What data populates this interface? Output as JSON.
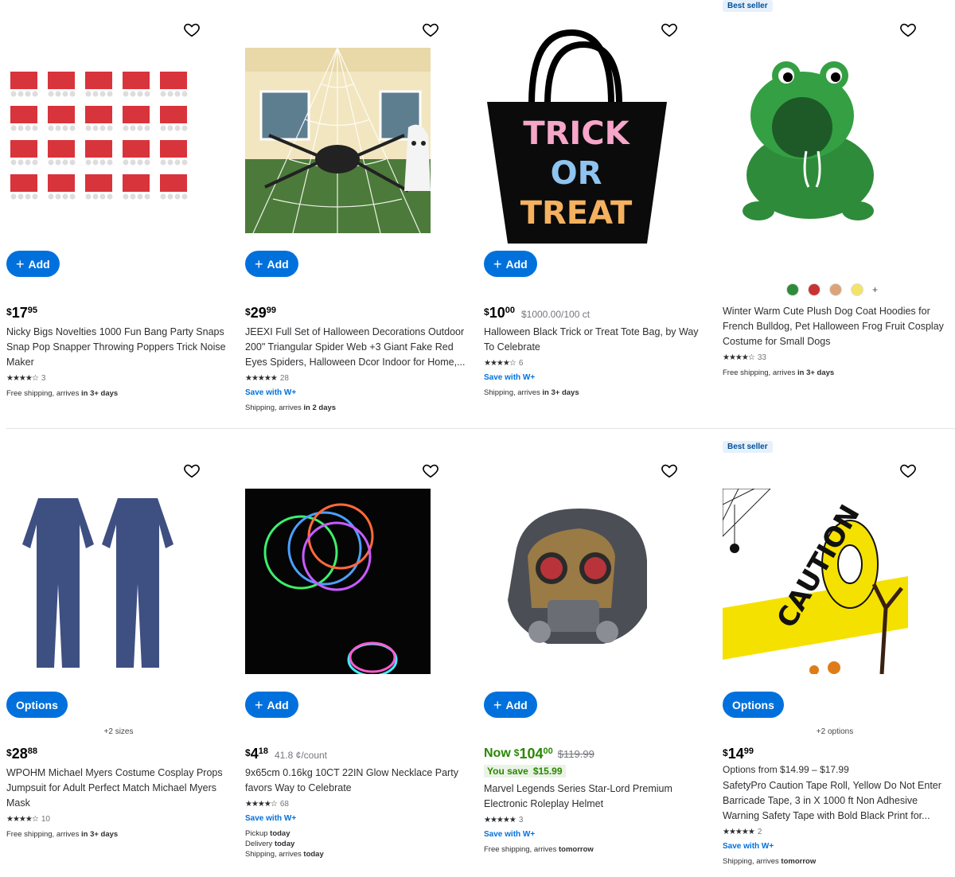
{
  "products": [
    {
      "badge": "",
      "button": "Add",
      "variants_text": "",
      "price": {
        "currency": "$",
        "dollars": "17",
        "cents": "95",
        "unit": ""
      },
      "title": "Nicky Bigs Novelties 1000 Fun Bang Party Snaps Snap Pop Snapper Throwing Poppers Trick Noise Maker",
      "stars": "★★★★☆",
      "rating_count": "3",
      "save_with": "",
      "shipping": [
        {
          "prefix": "Free shipping, arrives ",
          "bold": "in 3+ days"
        }
      ]
    },
    {
      "badge": "",
      "button": "Add",
      "variants_text": "",
      "price": {
        "currency": "$",
        "dollars": "29",
        "cents": "99",
        "unit": ""
      },
      "title": "JEEXI Full Set of Halloween Decorations Outdoor 200\" Triangular Spider Web +3 Giant Fake Red Eyes Spiders, Halloween Dcor Indoor for Home,...",
      "stars": "★★★★★",
      "rating_count": "28",
      "save_with": "Save with W+",
      "shipping": [
        {
          "prefix": "Shipping, arrives ",
          "bold": "in 2 days"
        }
      ]
    },
    {
      "badge": "",
      "button": "Add",
      "variants_text": "",
      "price": {
        "currency": "$",
        "dollars": "10",
        "cents": "00",
        "unit": "$1000.00/100 ct"
      },
      "title": "Halloween Black Trick or Treat Tote Bag, by Way To Celebrate",
      "stars": "★★★★☆",
      "rating_count": "6",
      "save_with": "Save with W+",
      "shipping": [
        {
          "prefix": "Shipping, arrives ",
          "bold": "in 3+ days"
        }
      ],
      "image_text": [
        "TRICK",
        "OR",
        "TREAT"
      ]
    },
    {
      "badge": "Best seller",
      "button": "",
      "variants_text": "+",
      "price": null,
      "title": "Winter Warm Cute Plush Dog Coat Hoodies for French Bulldog, Pet Halloween Frog Fruit Cosplay Costume for Small Dogs",
      "stars": "★★★★☆",
      "rating_count": "33",
      "save_with": "",
      "shipping": [
        {
          "prefix": "Free shipping, arrives ",
          "bold": "in 3+ days"
        }
      ]
    },
    {
      "badge": "",
      "button": "Options",
      "variants_text": "+2 sizes",
      "price": {
        "currency": "$",
        "dollars": "28",
        "cents": "88",
        "unit": ""
      },
      "title": "WPOHM Michael Myers Costume Cosplay Props Jumpsuit for Adult Perfect Match Michael Myers Mask",
      "stars": "★★★★☆",
      "rating_count": "10",
      "save_with": "",
      "shipping": [
        {
          "prefix": "Free shipping, arrives ",
          "bold": "in 3+ days"
        }
      ]
    },
    {
      "badge": "",
      "button": "Add",
      "variants_text": "",
      "price": {
        "currency": "$",
        "dollars": "4",
        "cents": "18",
        "unit": "41.8 ¢/count"
      },
      "title": "9x65cm 0.16kg 10CT 22IN Glow Necklace Party favors Way to Celebrate",
      "stars": "★★★★☆",
      "rating_count": "68",
      "save_with": "Save with W+",
      "shipping": [
        {
          "prefix": "Pickup ",
          "bold": "today"
        },
        {
          "prefix": "Delivery ",
          "bold": "today"
        },
        {
          "prefix": "Shipping, arrives ",
          "bold": "today"
        }
      ]
    },
    {
      "badge": "",
      "button": "Add",
      "variants_text": "",
      "price": {
        "currency": "$",
        "dollars": "104",
        "cents": "00",
        "now": "Now",
        "was": "$119.99",
        "you_save_label": "You save",
        "you_save_value": "$15.99"
      },
      "title": "Marvel Legends Series Star-Lord Premium Electronic Roleplay Helmet",
      "stars": "★★★★★",
      "rating_count": "3",
      "save_with": "Save with W+",
      "shipping": [
        {
          "prefix": "Free shipping, arrives ",
          "bold": "tomorrow"
        }
      ]
    },
    {
      "badge": "Best seller",
      "button": "Options",
      "variants_text": "+2 options",
      "price": {
        "currency": "$",
        "dollars": "14",
        "cents": "99",
        "unit": "",
        "from": "Options from $14.99 – $17.99"
      },
      "title": "SafetyPro Caution Tape Roll, Yellow Do Not Enter Barricade Tape, 3 in X 1000 ft Non Adhesive Warning Safety Tape with Bold Black Print for...",
      "stars": "★★★★★",
      "rating_count": "2",
      "save_with": "Save with W+",
      "shipping": [
        {
          "prefix": "Shipping, arrives ",
          "bold": "tomorrow"
        }
      ],
      "image_text": [
        "CAUTION"
      ]
    }
  ],
  "colors": {
    "primary": "#0071dc",
    "green": "#2a8703",
    "badge_bg": "#e6f1fc"
  },
  "icons": {
    "favorite": "heart-outline-icon",
    "add": "plus-icon",
    "star": "star-icon"
  }
}
